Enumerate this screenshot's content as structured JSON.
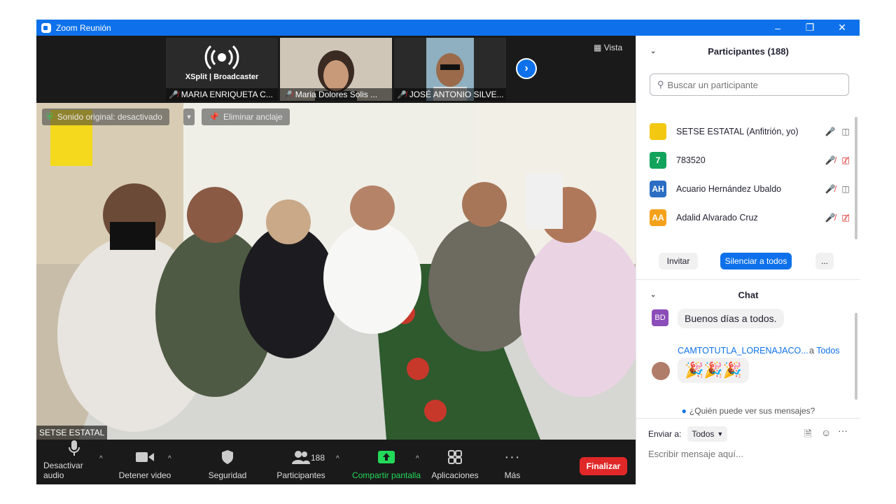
{
  "window": {
    "title": "Zoom Reunión"
  },
  "strip": {
    "thumbs": [
      {
        "name": "MARIA ENRIQUETA C...",
        "logo_title": "XSplit | Broadcaster"
      },
      {
        "name": "Maria Dolores Solis ..."
      },
      {
        "name": "JOSÉ ANTONIO SILVE..."
      }
    ],
    "view_label": "Vista"
  },
  "main_video": {
    "original_sound": "Sonido original: desactivado",
    "unpin": "Eliminar anclaje",
    "self_name": "SETSE ESTATAL"
  },
  "toolbar": {
    "mute": "Desactivar audio",
    "video": "Detener video",
    "security": "Seguridad",
    "participants": "Participantes",
    "participants_count": "188",
    "share": "Compartir pantalla",
    "apps": "Aplicaciones",
    "more": "Más",
    "end": "Finalizar"
  },
  "participants": {
    "header": "Participantes (188)",
    "search_placeholder": "Buscar un participante",
    "list": [
      {
        "name": "SETSE ESTATAL (Anfitrión, yo)",
        "initials": "",
        "color": "#f2c811",
        "muted": false,
        "video_off": false
      },
      {
        "name": "783520",
        "initials": "7",
        "color": "#11a35b",
        "muted": true,
        "video_off": true
      },
      {
        "name": "Acuario Hernández Ubaldo",
        "initials": "AH",
        "color": "#2b6ec4",
        "muted": true,
        "video_off": false
      },
      {
        "name": "Adalid Alvarado Cruz",
        "initials": "AA",
        "color": "#f5a21b",
        "muted": true,
        "video_off": true
      }
    ],
    "invite": "Invitar",
    "mute_all": "Silenciar a todos",
    "more": "..."
  },
  "chat": {
    "header": "Chat",
    "messages": [
      {
        "initials": "BD",
        "color": "#8b4db8",
        "text": "Buenos días a todos."
      },
      {
        "sender": "CAMTOTUTLA_LORENAJACO...",
        "to_prefix": "a",
        "to": "Todos",
        "text": "🎉🎉🎉"
      }
    ],
    "who_can_see": "¿Quién puede ver sus mensajes?",
    "send_to_label": "Enviar a:",
    "send_to_value": "Todos",
    "input_placeholder": "Escribir mensaje aquí..."
  },
  "colors": {
    "zoom_blue": "#0e71eb",
    "end_red": "#e02828",
    "share_green": "#23d959"
  }
}
